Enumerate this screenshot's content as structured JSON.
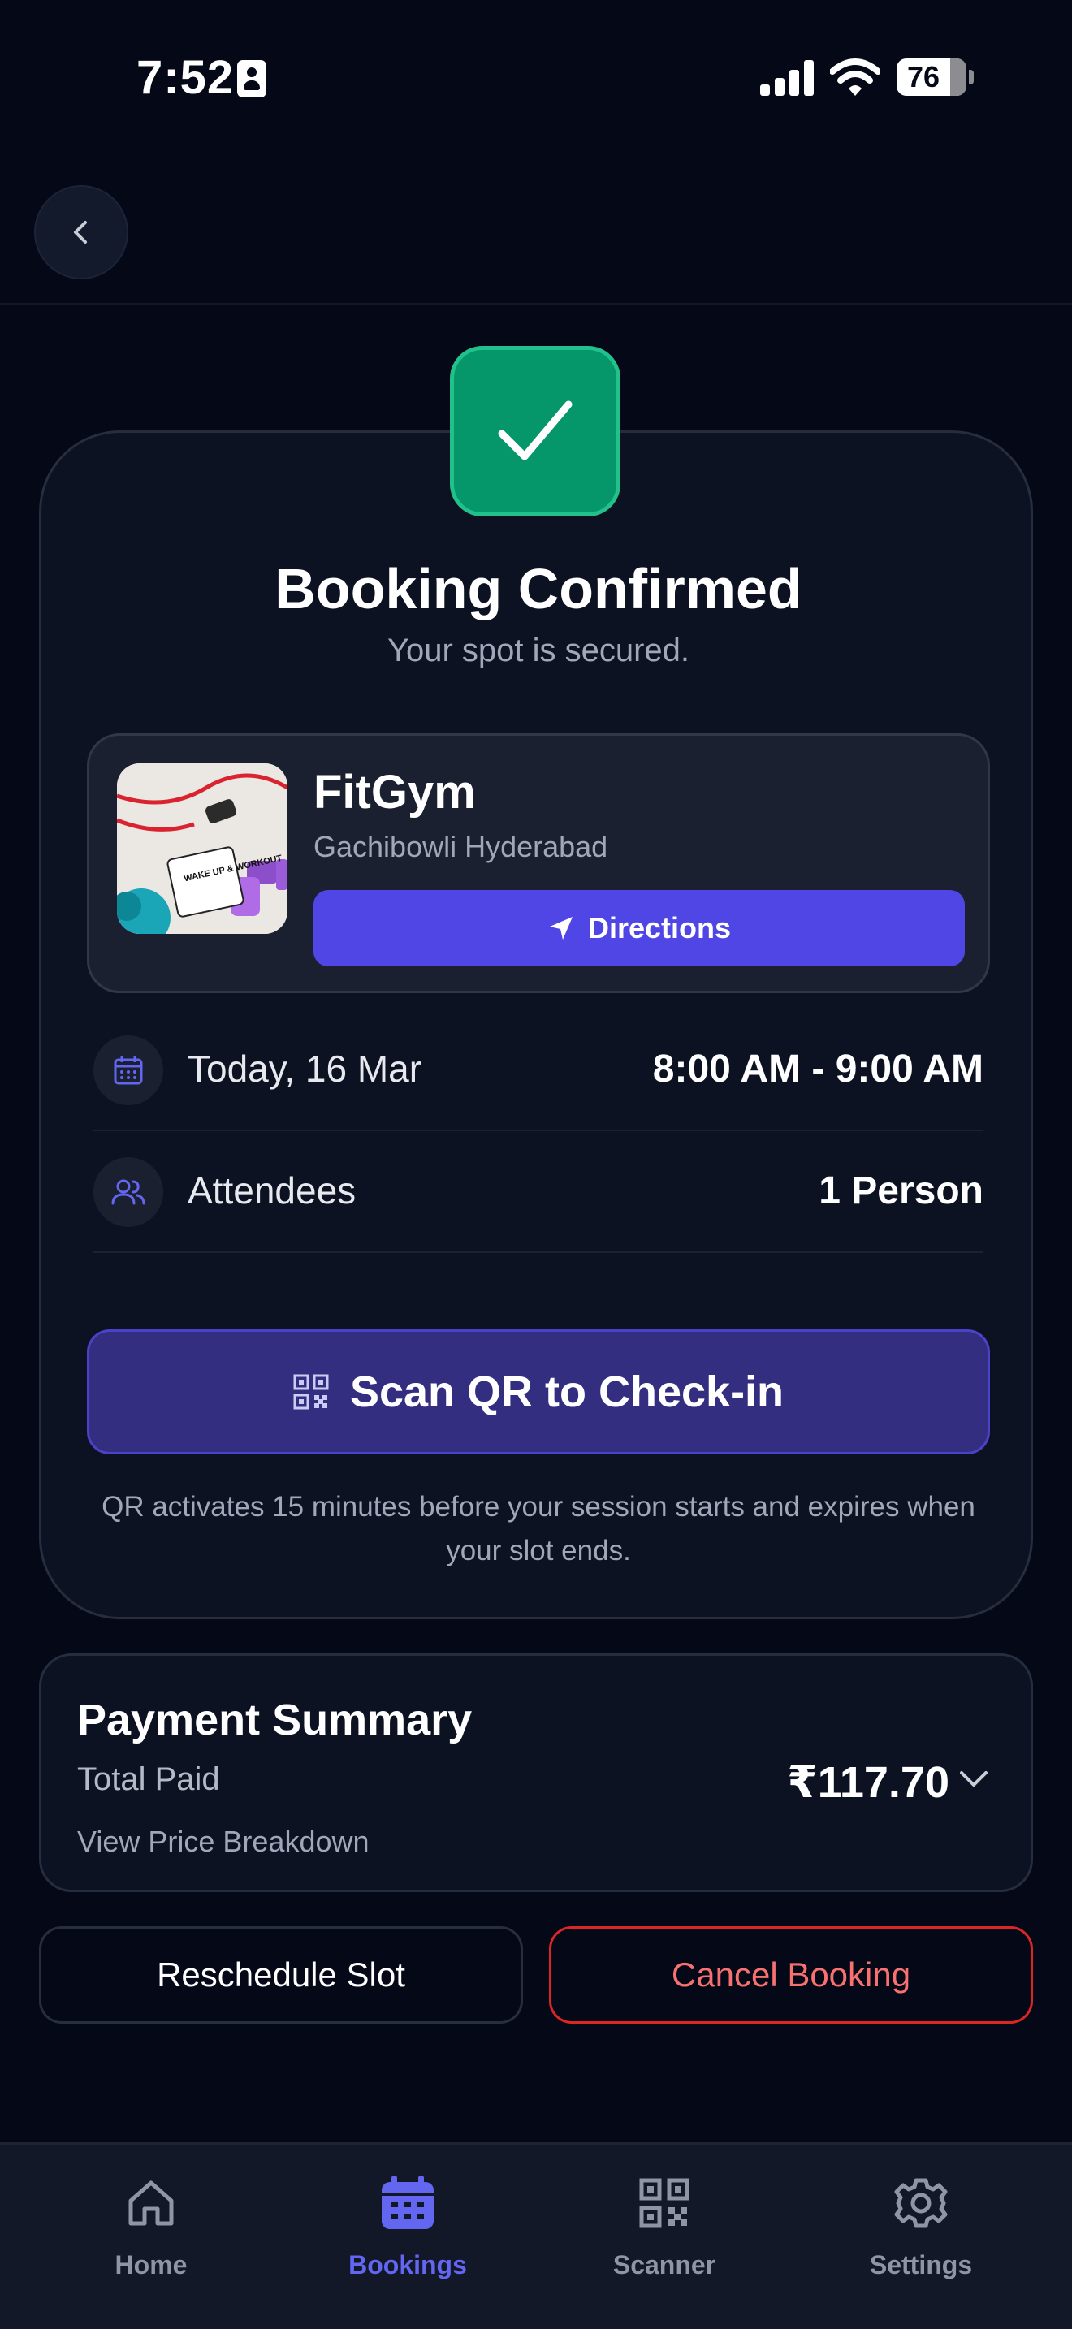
{
  "status_bar": {
    "time": "7:52",
    "battery": "76"
  },
  "booking": {
    "title": "Booking Confirmed",
    "subtitle": "Your spot is secured."
  },
  "gym": {
    "name": "FitGym",
    "location": "Gachibowli Hyderabad",
    "directions_label": "Directions",
    "photo_caption": "WAKE UP & WORKOUT"
  },
  "details": {
    "date": "Today, 16 Mar",
    "time_range": "8:00 AM - 9:00 AM",
    "attendees_label": "Attendees",
    "attendees_value": "1 Person"
  },
  "scan": {
    "label": "Scan QR to Check-in",
    "note": "QR activates 15 minutes before your session starts and expires when your slot ends."
  },
  "payment": {
    "title": "Payment Summary",
    "total_label": "Total Paid",
    "amount": "₹117.70",
    "breakdown_label": "View Price Breakdown"
  },
  "actions": {
    "reschedule_label": "Reschedule Slot",
    "cancel_label": "Cancel Booking"
  },
  "tabs": [
    {
      "label": "Home",
      "icon": "home-icon"
    },
    {
      "label": "Bookings",
      "icon": "calendar-icon",
      "active": true
    },
    {
      "label": "Scanner",
      "icon": "qr-icon"
    },
    {
      "label": "Settings",
      "icon": "gear-icon"
    }
  ],
  "colors": {
    "background": "#050816",
    "accent": "#4f46e5",
    "success": "#059669",
    "danger": "#dc2626"
  }
}
